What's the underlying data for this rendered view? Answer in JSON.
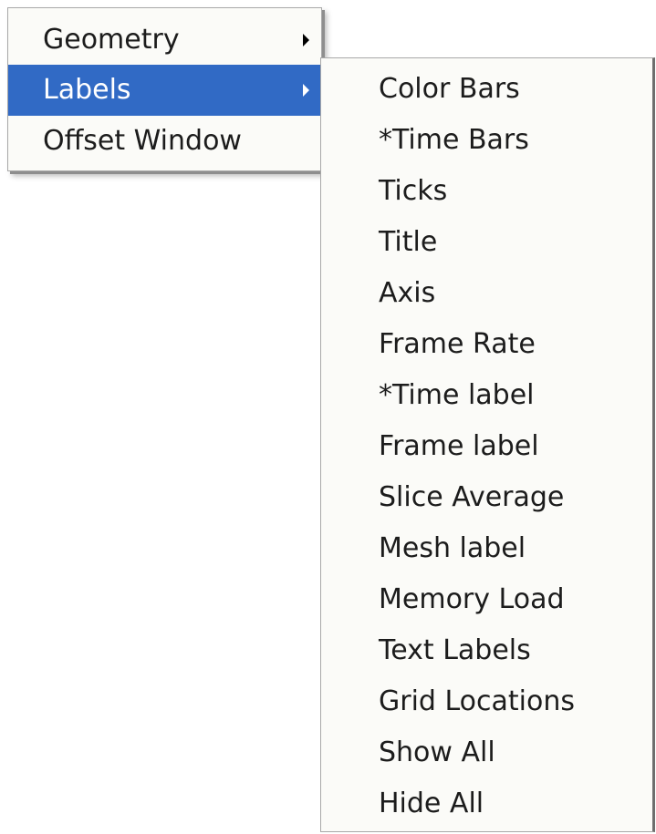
{
  "main_menu": {
    "items": [
      {
        "label": "Geometry",
        "has_submenu": true,
        "selected": false
      },
      {
        "label": "Labels",
        "has_submenu": true,
        "selected": true
      },
      {
        "label": "Offset Window",
        "has_submenu": false,
        "selected": false
      }
    ]
  },
  "labels_submenu": {
    "items": [
      {
        "label": "Color Bars"
      },
      {
        "label": "*Time Bars"
      },
      {
        "label": "Ticks"
      },
      {
        "label": "Title"
      },
      {
        "label": "Axis"
      },
      {
        "label": "Frame Rate"
      },
      {
        "label": "*Time label"
      },
      {
        "label": "Frame label"
      },
      {
        "label": "Slice Average"
      },
      {
        "label": "Mesh label"
      },
      {
        "label": "Memory Load"
      },
      {
        "label": "Text Labels"
      },
      {
        "label": "Grid Locations"
      },
      {
        "label": "Show All"
      },
      {
        "label": "Hide All"
      }
    ]
  },
  "colors": {
    "selection": "#316ac5",
    "menu_background": "#fbfbf8",
    "text": "#1c1c1c",
    "selected_text": "#ffffff"
  }
}
